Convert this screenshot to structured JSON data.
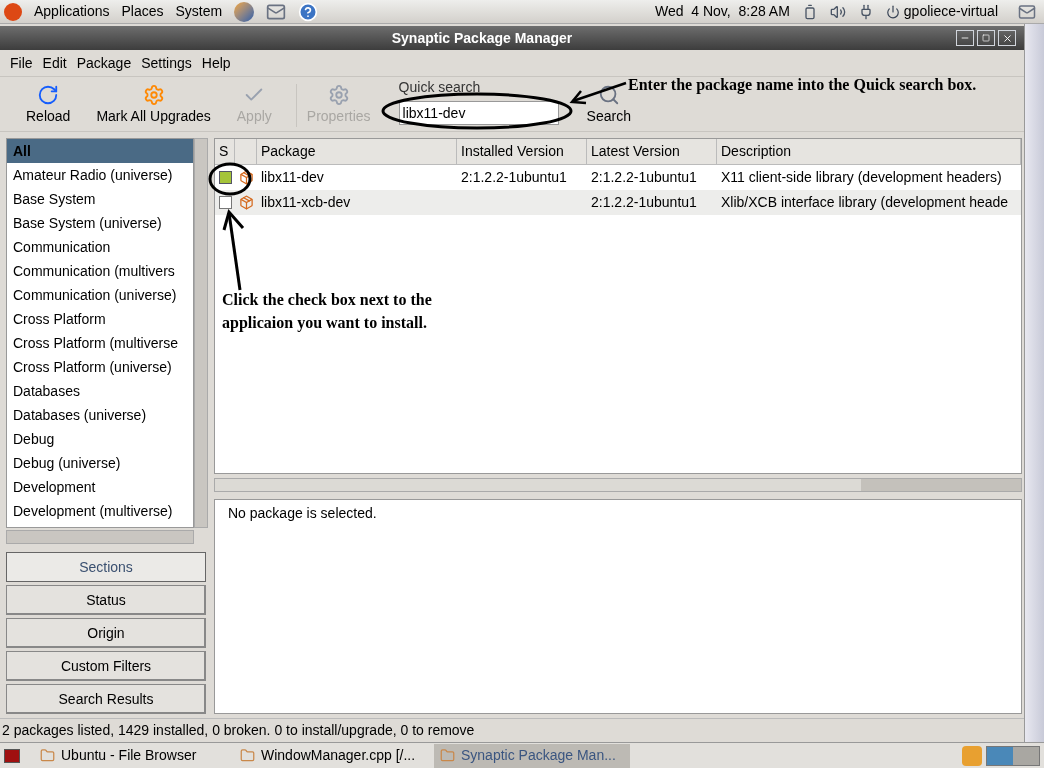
{
  "top_panel": {
    "menus": [
      "Applications",
      "Places",
      "System"
    ],
    "clock": "Wed  4 Nov,  8:28 AM",
    "user": "gpoliece-virtual"
  },
  "window": {
    "title": "Synaptic Package Manager"
  },
  "menu_bar": [
    "File",
    "Edit",
    "Package",
    "Settings",
    "Help"
  ],
  "toolbar": [
    {
      "label": "Reload",
      "disabled": false,
      "kind": "reload"
    },
    {
      "label": "Mark All Upgrades",
      "disabled": false,
      "kind": "upgrade"
    },
    {
      "label": "Apply",
      "disabled": true,
      "kind": "apply"
    },
    {
      "label": "Properties",
      "disabled": true,
      "kind": "properties"
    }
  ],
  "quick_search": {
    "label": "Quick search",
    "value": "libx11-dev",
    "button": "Search"
  },
  "sections": [
    {
      "label": "All",
      "selected": true
    },
    {
      "label": "Amateur Radio (universe)",
      "selected": false
    },
    {
      "label": "Base System",
      "selected": false
    },
    {
      "label": "Base System (universe)",
      "selected": false
    },
    {
      "label": "Communication",
      "selected": false
    },
    {
      "label": "Communication (multivers",
      "selected": false
    },
    {
      "label": "Communication (universe)",
      "selected": false
    },
    {
      "label": "Cross Platform",
      "selected": false
    },
    {
      "label": "Cross Platform (multiverse",
      "selected": false
    },
    {
      "label": "Cross Platform (universe)",
      "selected": false
    },
    {
      "label": "Databases",
      "selected": false
    },
    {
      "label": "Databases (universe)",
      "selected": false
    },
    {
      "label": "Debug",
      "selected": false
    },
    {
      "label": "Debug (universe)",
      "selected": false
    },
    {
      "label": "Development",
      "selected": false
    },
    {
      "label": "Development (multiverse)",
      "selected": false
    }
  ],
  "filter_buttons": [
    {
      "label": "Sections",
      "selected": true
    },
    {
      "label": "Status",
      "selected": false
    },
    {
      "label": "Origin",
      "selected": false
    },
    {
      "label": "Custom Filters",
      "selected": false
    },
    {
      "label": "Search Results",
      "selected": false
    }
  ],
  "table": {
    "columns": [
      "S",
      "Package",
      "Installed Version",
      "Latest Version",
      "Description"
    ],
    "rows": [
      {
        "checked": true,
        "package": "libx11-dev",
        "installed": "2:1.2.2-1ubuntu1",
        "latest": "2:1.2.2-1ubuntu1",
        "description": "X11 client-side library (development headers)"
      },
      {
        "checked": false,
        "package": "libx11-xcb-dev",
        "installed": "",
        "latest": "2:1.2.2-1ubuntu1",
        "description": "Xlib/XCB interface library (development heade"
      }
    ]
  },
  "details": "No package is selected.",
  "status_bar": "2 packages listed, 1429 installed, 0 broken. 0 to install/upgrade, 0 to remove",
  "taskbar": [
    {
      "label": "Ubuntu - File Browser",
      "selected": false
    },
    {
      "label": "WindowManager.cpp [/...",
      "selected": false
    },
    {
      "label": "Synaptic Package Man...",
      "selected": true
    }
  ],
  "annotations": [
    "Enter the package name into the Quick search box.",
    "Click the check box next to the applicaion you want to install."
  ]
}
